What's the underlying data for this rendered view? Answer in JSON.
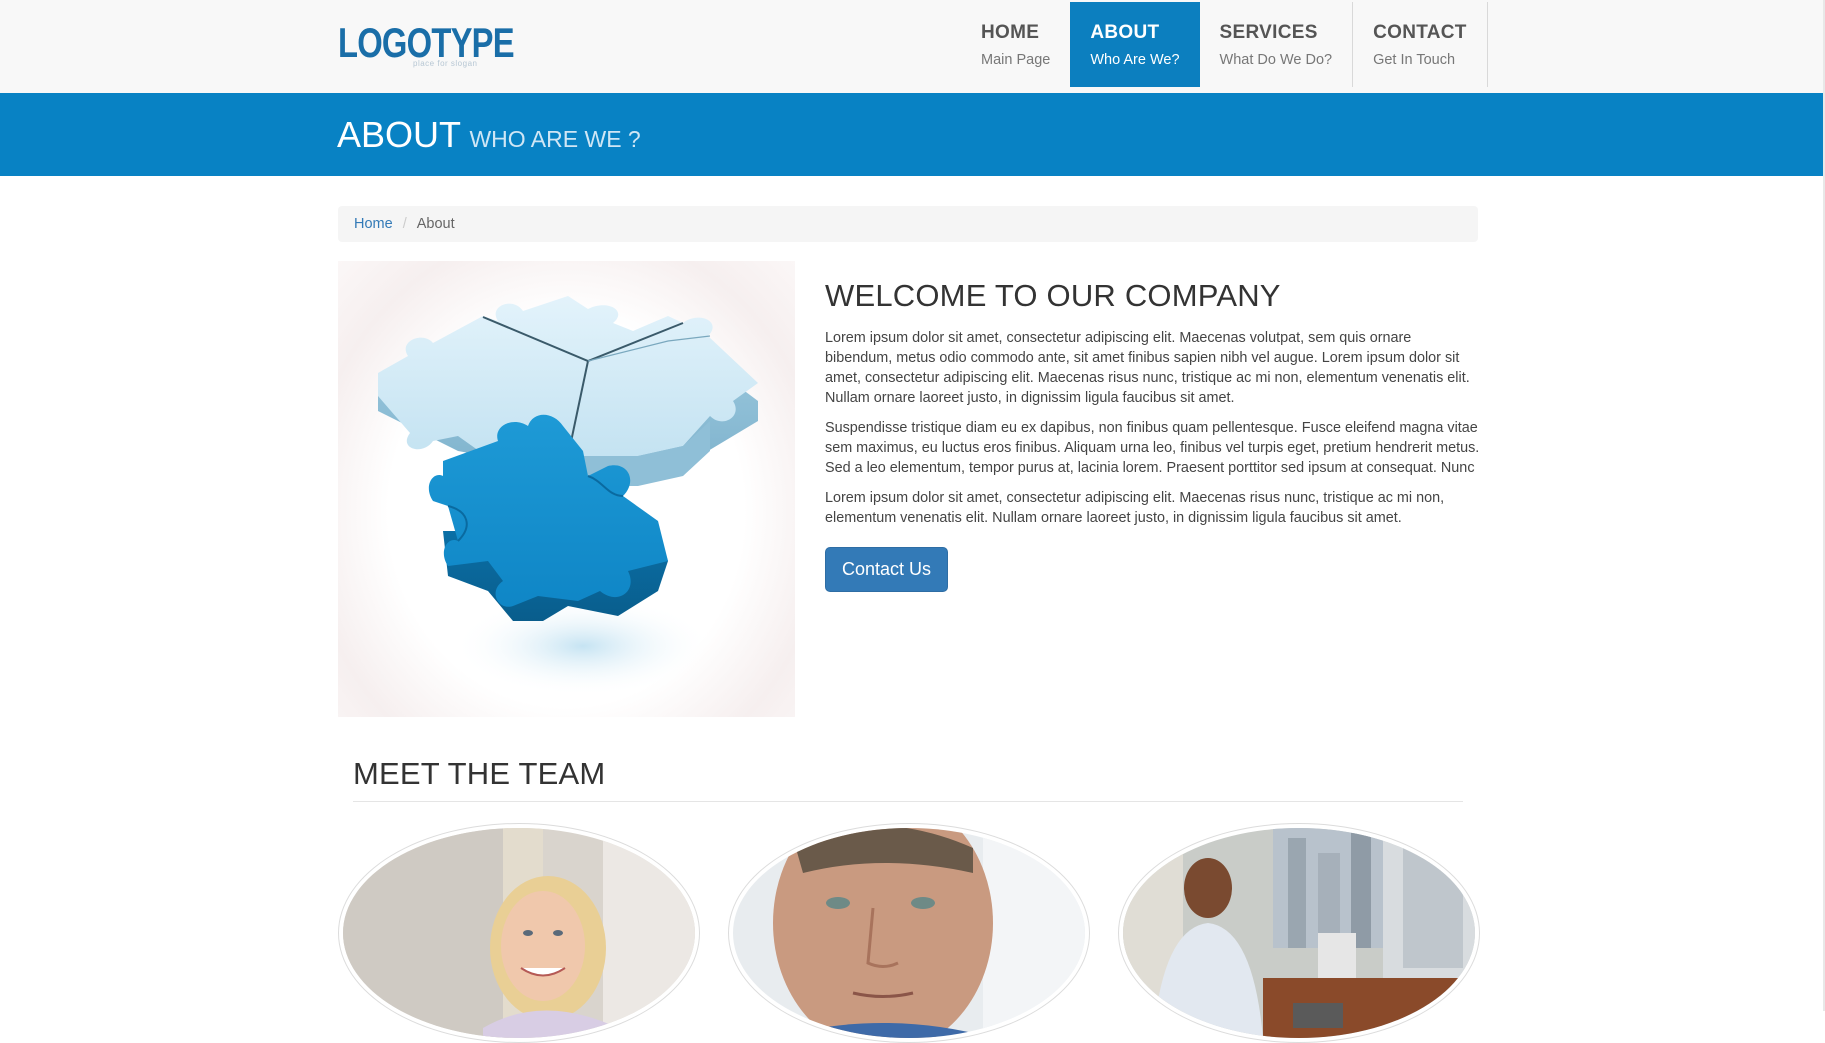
{
  "logo": {
    "text": "LOGOTYPE",
    "tagline": "place for slogan"
  },
  "nav": [
    {
      "title": "HOME",
      "subtitle": "Main Page"
    },
    {
      "title": "ABOUT",
      "subtitle": "Who Are We?"
    },
    {
      "title": "SERVICES",
      "subtitle": "What Do We Do?"
    },
    {
      "title": "CONTACT",
      "subtitle": "Get In Touch"
    }
  ],
  "band": {
    "title": "ABOUT",
    "subtitle": "WHO ARE WE ?"
  },
  "breadcrumb": {
    "home": "Home",
    "separator": "/",
    "current": "About"
  },
  "welcome": {
    "heading": "WELCOME TO OUR COMPANY",
    "paragraphs": [
      "Lorem ipsum dolor sit amet, consectetur adipiscing elit. Maecenas volutpat, sem quis ornare bibendum, metus odio commodo ante, sit amet finibus sapien nibh vel augue. Lorem ipsum dolor sit amet, consectetur adipiscing elit. Maecenas risus nunc, tristique ac mi non, elementum venenatis elit. Nullam ornare laoreet justo, in dignissim ligula faucibus sit amet.",
      "Suspendisse tristique diam eu ex dapibus, non finibus quam pellentesque. Fusce eleifend magna vitae sem maximus, eu luctus eros finibus. Aliquam urna leo, finibus vel turpis eget, pretium hendrerit metus. Sed a leo elementum, tempor purus at, lacinia lorem. Praesent porttitor sed ipsum at consequat. Nunc",
      "Lorem ipsum dolor sit amet, consectetur adipiscing elit. Maecenas risus nunc, tristique ac mi non, elementum venenatis elit. Nullam ornare laoreet justo, in dignissim ligula faucibus sit amet."
    ],
    "button": "Contact Us"
  },
  "team": {
    "heading": "MEET THE TEAM"
  },
  "colors": {
    "brand_blue": "#0882c4",
    "active_nav": "#0c7fbf",
    "button_blue": "#337ab7",
    "navbar_bg": "#f8f8f8"
  },
  "icons": {
    "logo": "power-icon",
    "hero": "puzzle-pieces-image",
    "team_1": "woman-portrait-photo",
    "team_2": "man-portrait-photo",
    "team_3": "office-worker-photo"
  }
}
